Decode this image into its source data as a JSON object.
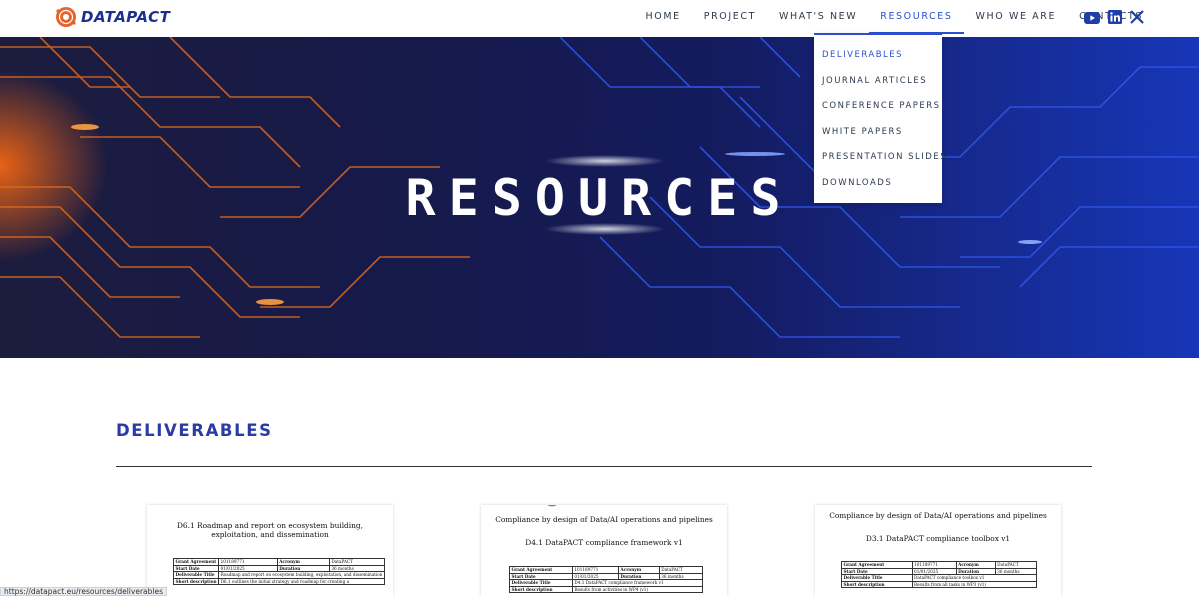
{
  "brand": {
    "name": "DATAPACT",
    "accent": "#2c4fcf",
    "logo_orange": "#e8632a",
    "logo_blue": "#1d2f8f"
  },
  "nav": {
    "items": [
      {
        "label": "HOME",
        "active": false
      },
      {
        "label": "PROJECT",
        "active": false
      },
      {
        "label": "WHAT'S NEW",
        "active": false
      },
      {
        "label": "RESOURCES",
        "active": true
      },
      {
        "label": "WHO WE ARE",
        "active": false
      },
      {
        "label": "CONTACTS",
        "active": false
      }
    ],
    "social": [
      "youtube-icon",
      "linkedin-icon",
      "x-icon"
    ]
  },
  "dropdown": {
    "items": [
      {
        "label": "DELIVERABLES",
        "active": true
      },
      {
        "label": "JOURNAL ARTICLES",
        "active": false
      },
      {
        "label": "CONFERENCE PAPERS",
        "active": false
      },
      {
        "label": "WHITE PAPERS",
        "active": false
      },
      {
        "label": "PRESENTATION SLIDES",
        "active": false
      },
      {
        "label": "DOWNLOADS",
        "active": false
      }
    ]
  },
  "hero": {
    "title": "RESOURCES"
  },
  "section": {
    "title": "DELIVERABLES"
  },
  "cards": [
    {
      "title_lines": [
        "D6.1 Roadmap and report on ecosystem building,",
        "exploitation, and dissemination"
      ],
      "rows": [
        [
          "Grant Agreement",
          "101189771",
          "Acronym",
          "DataPACT"
        ],
        [
          "Start Date",
          "01/01/2025",
          "Duration",
          "36 months"
        ],
        [
          "Deliverable Title",
          "Roadmap and report on ecosystem building, exploitation, and dissemination",
          "",
          ""
        ],
        [
          "Short description",
          "D6.1 outlines the initial strategy and roadmap for creating a",
          "",
          ""
        ]
      ]
    },
    {
      "title_lines": [
        "Compliance by design of Data/AI operations and pipelines",
        "D4.1 DataPACT compliance framework v1"
      ],
      "rows": [
        [
          "Grant Agreement",
          "101189771",
          "Acronym",
          "DataPACT"
        ],
        [
          "Start Date",
          "01/01/2025",
          "Duration",
          "36 months"
        ],
        [
          "Deliverable Title",
          "D4.1 DataPACT compliance framework v1",
          "",
          ""
        ],
        [
          "Short description",
          "Results from activities in WP4 (v1)",
          "",
          ""
        ]
      ]
    },
    {
      "title_lines": [
        "Compliance by design of Data/AI operations and pipelines",
        "D3.1 DataPACT compliance toolbox v1"
      ],
      "rows": [
        [
          "Grant Agreement",
          "101189771",
          "Acronym",
          "DataPACT"
        ],
        [
          "Start Date",
          "01/01/2025",
          "Duration",
          "36 months"
        ],
        [
          "Deliverable Title",
          "DataPACT compliance toolbox v1",
          "",
          ""
        ],
        [
          "Short description",
          "Results from all tasks in WP3 (v1)",
          "",
          ""
        ]
      ]
    }
  ],
  "status_bar": {
    "url": "https://datapact.eu/resources/deliverables"
  }
}
